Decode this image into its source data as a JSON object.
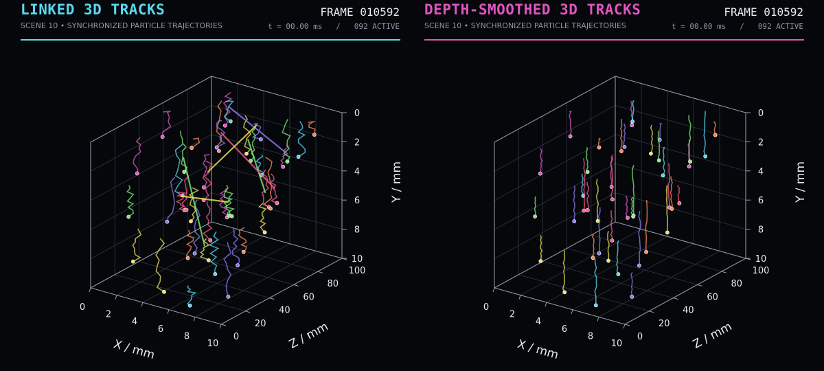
{
  "panels": [
    {
      "title": "LINKED 3D TRACKS",
      "frame": "FRAME 010592",
      "subtitle": "SCENE 10 • SYNCHRONIZED PARTICLE TRAJECTORIES",
      "status": "t = 00.00 ms   /   092 ACTIVE",
      "accent": "#5ad8f0"
    },
    {
      "title": "DEPTH-SMOOTHED 3D TRACKS",
      "frame": "FRAME 010592",
      "subtitle": "SCENE 10 • SYNCHRONIZED PARTICLE TRAJECTORIES",
      "status": "t = 00.00 ms   /   092 ACTIVE",
      "accent": "#e055c0"
    }
  ],
  "chart_data": [
    {
      "type": "scatter",
      "projection": "3d",
      "title": "LINKED 3D TRACKS",
      "xlabel": "X / mm",
      "ylabel": "Y / mm",
      "zlabel": "Z / mm",
      "xlim": [
        0,
        10
      ],
      "ylim": [
        10,
        0
      ],
      "zlim": [
        0,
        100
      ],
      "xticks": [
        0,
        2,
        4,
        6,
        8,
        10
      ],
      "yticks": [
        0,
        2,
        4,
        6,
        8,
        10
      ],
      "zticks": [
        0,
        20,
        40,
        60,
        80,
        100
      ],
      "grid": true,
      "series_count": 92,
      "colors": [
        "#5ad8f0",
        "#e055c0",
        "#f2e35a",
        "#7cf07a",
        "#8a7cf0",
        "#ff8a5a",
        "#ff5a8a"
      ],
      "tracks": [
        {
          "x": 1.2,
          "y": 6.1,
          "z": 60
        },
        {
          "x": 2.0,
          "y": 2.5,
          "z": 92
        },
        {
          "x": 2.8,
          "y": 7.2,
          "z": 55
        },
        {
          "x": 3.4,
          "y": 3.0,
          "z": 40
        },
        {
          "x": 4.1,
          "y": 5.4,
          "z": 22
        },
        {
          "x": 4.8,
          "y": 8.1,
          "z": 30
        },
        {
          "x": 5.5,
          "y": 4.0,
          "z": 15
        },
        {
          "x": 6.2,
          "y": 9.1,
          "z": 35
        },
        {
          "x": 7.1,
          "y": 2.2,
          "z": 20
        },
        {
          "x": 8.0,
          "y": 6.5,
          "z": 8
        },
        {
          "x": 8.9,
          "y": 3.7,
          "z": 18
        },
        {
          "x": 9.4,
          "y": 8.8,
          "z": 12
        },
        {
          "x": 1.6,
          "y": 4.2,
          "z": 88
        },
        {
          "x": 2.5,
          "y": 9.3,
          "z": 70
        },
        {
          "x": 3.2,
          "y": 1.4,
          "z": 80
        },
        {
          "x": 4.4,
          "y": 6.9,
          "z": 62
        },
        {
          "x": 5.1,
          "y": 2.9,
          "z": 75
        },
        {
          "x": 6.0,
          "y": 5.8,
          "z": 50
        },
        {
          "x": 6.7,
          "y": 1.1,
          "z": 65
        },
        {
          "x": 7.5,
          "y": 7.7,
          "z": 45
        },
        {
          "x": 8.3,
          "y": 4.9,
          "z": 55
        },
        {
          "x": 9.1,
          "y": 1.9,
          "z": 42
        },
        {
          "x": 0.8,
          "y": 3.3,
          "z": 30
        },
        {
          "x": 1.9,
          "y": 8.5,
          "z": 18
        },
        {
          "x": 3.8,
          "y": 4.6,
          "z": 95
        },
        {
          "x": 4.6,
          "y": 1.8,
          "z": 58
        },
        {
          "x": 5.7,
          "y": 7.0,
          "z": 85
        },
        {
          "x": 6.4,
          "y": 3.6,
          "z": 28
        },
        {
          "x": 7.3,
          "y": 9.6,
          "z": 5
        },
        {
          "x": 8.6,
          "y": 2.6,
          "z": 68
        },
        {
          "x": 9.7,
          "y": 5.5,
          "z": 38
        },
        {
          "x": 2.2,
          "y": 5.0,
          "z": 10
        },
        {
          "x": 3.6,
          "y": 8.9,
          "z": 48
        },
        {
          "x": 5.0,
          "y": 0.6,
          "z": 33
        },
        {
          "x": 6.9,
          "y": 6.0,
          "z": 78
        },
        {
          "x": 7.8,
          "y": 3.1,
          "z": 90
        },
        {
          "x": 1.0,
          "y": 1.7,
          "z": 52
        },
        {
          "x": 4.2,
          "y": 9.8,
          "z": 12
        },
        {
          "x": 5.9,
          "y": 4.3,
          "z": 98
        },
        {
          "x": 8.8,
          "y": 7.4,
          "z": 25
        },
        {
          "x": 9.3,
          "y": 0.9,
          "z": 82
        },
        {
          "x": 0.5,
          "y": 7.8,
          "z": 72
        }
      ]
    },
    {
      "type": "scatter",
      "projection": "3d",
      "title": "DEPTH-SMOOTHED 3D TRACKS",
      "xlabel": "X / mm",
      "ylabel": "Y / mm",
      "zlabel": "Z / mm",
      "xlim": [
        0,
        10
      ],
      "ylim": [
        10,
        0
      ],
      "zlim": [
        0,
        100
      ],
      "xticks": [
        0,
        2,
        4,
        6,
        8,
        10
      ],
      "yticks": [
        0,
        2,
        4,
        6,
        8,
        10
      ],
      "zticks": [
        0,
        20,
        40,
        60,
        80,
        100
      ],
      "grid": true,
      "series_count": 92,
      "colors": [
        "#5ad8f0",
        "#e055c0",
        "#f2e35a",
        "#7cf07a",
        "#8a7cf0",
        "#ff8a5a",
        "#ff5a8a"
      ],
      "tracks": [
        {
          "x": 1.2,
          "y": 6.1,
          "z": 60
        },
        {
          "x": 2.0,
          "y": 2.5,
          "z": 92
        },
        {
          "x": 2.8,
          "y": 7.2,
          "z": 55
        },
        {
          "x": 3.4,
          "y": 3.0,
          "z": 40
        },
        {
          "x": 4.1,
          "y": 5.4,
          "z": 22
        },
        {
          "x": 4.8,
          "y": 8.1,
          "z": 30
        },
        {
          "x": 5.5,
          "y": 4.0,
          "z": 15
        },
        {
          "x": 6.2,
          "y": 9.1,
          "z": 35
        },
        {
          "x": 7.1,
          "y": 2.2,
          "z": 20
        },
        {
          "x": 8.0,
          "y": 6.5,
          "z": 8
        },
        {
          "x": 8.9,
          "y": 3.7,
          "z": 18
        },
        {
          "x": 9.4,
          "y": 8.8,
          "z": 12
        },
        {
          "x": 1.6,
          "y": 4.2,
          "z": 88
        },
        {
          "x": 2.5,
          "y": 9.3,
          "z": 70
        },
        {
          "x": 3.2,
          "y": 1.4,
          "z": 80
        },
        {
          "x": 4.4,
          "y": 6.9,
          "z": 62
        },
        {
          "x": 5.1,
          "y": 2.9,
          "z": 75
        },
        {
          "x": 6.0,
          "y": 5.8,
          "z": 50
        },
        {
          "x": 6.7,
          "y": 1.1,
          "z": 65
        },
        {
          "x": 7.5,
          "y": 7.7,
          "z": 45
        },
        {
          "x": 8.3,
          "y": 4.9,
          "z": 55
        },
        {
          "x": 9.1,
          "y": 1.9,
          "z": 42
        },
        {
          "x": 0.8,
          "y": 3.3,
          "z": 30
        },
        {
          "x": 1.9,
          "y": 8.5,
          "z": 18
        },
        {
          "x": 3.8,
          "y": 4.6,
          "z": 95
        },
        {
          "x": 4.6,
          "y": 1.8,
          "z": 58
        },
        {
          "x": 5.7,
          "y": 7.0,
          "z": 85
        },
        {
          "x": 6.4,
          "y": 3.6,
          "z": 28
        },
        {
          "x": 7.3,
          "y": 9.6,
          "z": 5
        },
        {
          "x": 8.6,
          "y": 2.6,
          "z": 68
        },
        {
          "x": 9.7,
          "y": 5.5,
          "z": 38
        },
        {
          "x": 2.2,
          "y": 5.0,
          "z": 10
        },
        {
          "x": 3.6,
          "y": 8.9,
          "z": 48
        },
        {
          "x": 5.0,
          "y": 0.6,
          "z": 33
        },
        {
          "x": 6.9,
          "y": 6.0,
          "z": 78
        },
        {
          "x": 7.8,
          "y": 3.1,
          "z": 90
        },
        {
          "x": 1.0,
          "y": 1.7,
          "z": 52
        },
        {
          "x": 4.2,
          "y": 9.8,
          "z": 12
        },
        {
          "x": 5.9,
          "y": 4.3,
          "z": 98
        },
        {
          "x": 8.8,
          "y": 7.4,
          "z": 25
        },
        {
          "x": 9.3,
          "y": 0.9,
          "z": 82
        },
        {
          "x": 0.5,
          "y": 7.8,
          "z": 72
        }
      ]
    }
  ]
}
